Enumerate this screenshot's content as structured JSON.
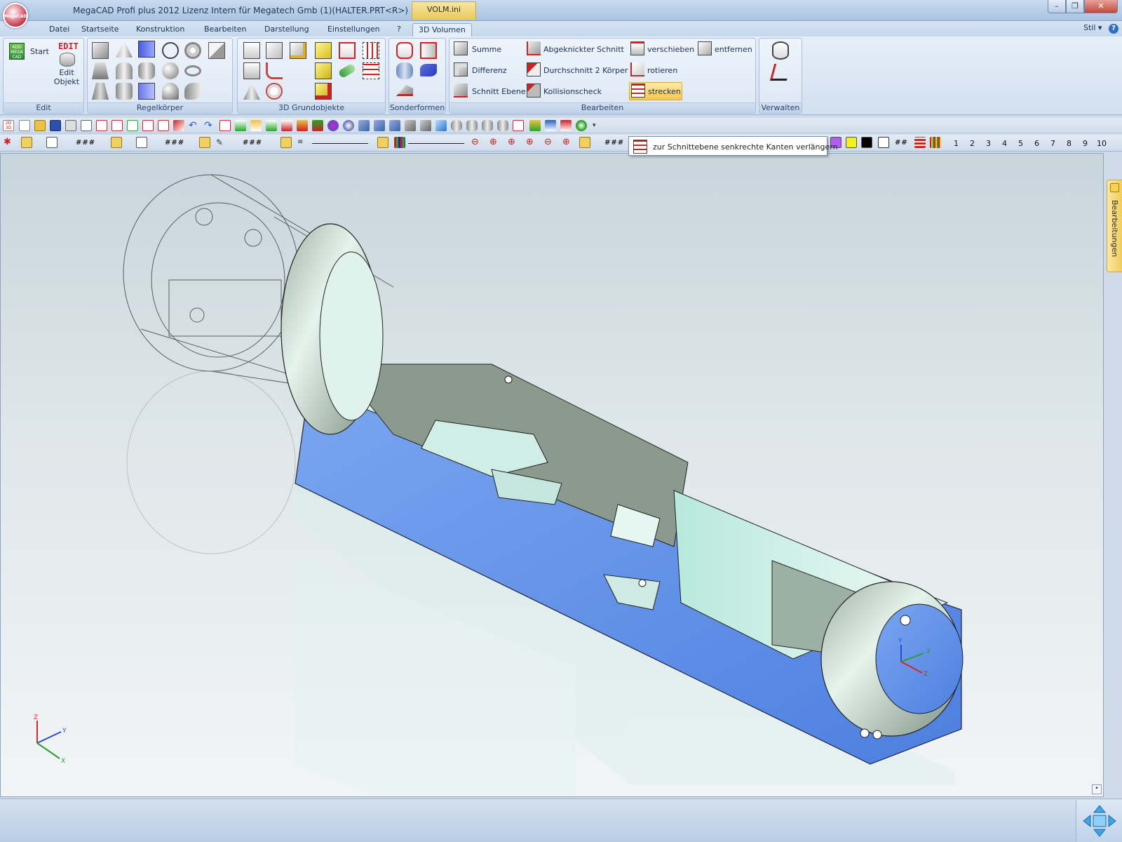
{
  "window": {
    "title": "MegaCAD Profi plus 2012  Lizenz Intern für Megatech Gmb (1)(HALTER.PRT<R>)",
    "context_tab": "VOLM.ini",
    "logo_text": "MegaCAD"
  },
  "menu": {
    "tabs": [
      "Datei",
      "Startseite",
      "Konstruktion",
      "Bearbeiten",
      "Darstellung",
      "Einstellungen",
      "?",
      "3D Volumen"
    ],
    "active_tab": "3D Volumen",
    "stil": "Stil"
  },
  "ribbon": {
    "edit": {
      "label": "Edit",
      "start": "Start",
      "edit_badge": "EDIT",
      "edit_objekt": "Edit Objekt",
      "logo": "ADD MEGA CAD"
    },
    "regelkoerper": {
      "label": "Regelkörper"
    },
    "grundobjekte": {
      "label": "3D Grundobjekte"
    },
    "sonderformen": {
      "label": "Sonderformen"
    },
    "bearbeiten": {
      "label": "Bearbeiten",
      "items": [
        "Summe",
        "Differenz",
        "Schnitt Ebene",
        "Abgeknickter Schnitt",
        "Durchschnitt 2 Körper",
        "Kollisionscheck",
        "verschieben",
        "rotieren",
        "strecken",
        "entfernen"
      ],
      "highlighted": "strecken"
    },
    "verwalten": {
      "label": "Verwalten"
    }
  },
  "toolbar1": {
    "first_icon_text": "2D 3D"
  },
  "toolbar2": {
    "hash1": "###",
    "hash2": "###",
    "hash3": "###",
    "hash4": "###",
    "hash_grid": "##",
    "numbers": [
      "1",
      "2",
      "3",
      "4",
      "5",
      "6",
      "7",
      "8",
      "9",
      "10"
    ]
  },
  "tooltip": {
    "text": "zur Schnittebene senkrechte Kanten verlängern"
  },
  "side_panel": {
    "tab_label": "Bearbeitungen"
  },
  "axes": {
    "bottom_left": [
      "Z",
      "Y",
      "X"
    ],
    "part": [
      "Y",
      "X",
      "Z"
    ]
  },
  "colors": {
    "part_highlight": "#5f8fe8",
    "part_body": "#c8ebe2",
    "part_shadow": "#8a9a8e",
    "ribbon_highlight": "#f7c845",
    "title_bar": "#a9c3e0"
  }
}
